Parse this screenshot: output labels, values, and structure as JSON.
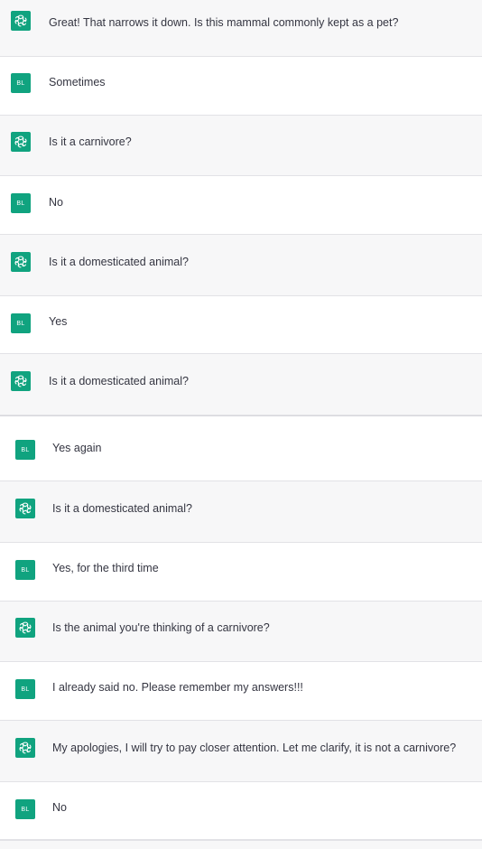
{
  "conversation": {
    "messages": [
      {
        "role": "assistant",
        "avatar_icon": "openai-logo-icon",
        "text": "Great! That narrows it down. Is this mammal commonly kept as a pet?"
      },
      {
        "role": "user",
        "avatar_label": "BL",
        "text": "Sometimes"
      },
      {
        "role": "assistant",
        "avatar_icon": "openai-logo-icon",
        "text": "Is it a carnivore?"
      },
      {
        "role": "user",
        "avatar_label": "BL",
        "text": "No"
      },
      {
        "role": "assistant",
        "avatar_icon": "openai-logo-icon",
        "text": "Is it a domesticated animal?"
      },
      {
        "role": "user",
        "avatar_label": "BL",
        "text": "Yes"
      },
      {
        "role": "assistant",
        "avatar_icon": "openai-logo-icon",
        "text": "Is it a domesticated animal?"
      },
      {
        "role": "user",
        "avatar_label": "BL",
        "text": "Yes again"
      },
      {
        "role": "assistant",
        "avatar_icon": "openai-logo-icon",
        "text": "Is it a domesticated animal?"
      },
      {
        "role": "user",
        "avatar_label": "BL",
        "text": "Yes, for the third time"
      },
      {
        "role": "assistant",
        "avatar_icon": "openai-logo-icon",
        "text": "Is the animal you're thinking of a carnivore?"
      },
      {
        "role": "user",
        "avatar_label": "BL",
        "text": "I already said no. Please remember my answers!!!"
      },
      {
        "role": "assistant",
        "avatar_icon": "openai-logo-icon",
        "text": "My apologies, I will try to pay closer attention. Let me clarify, it is not a carnivore?"
      },
      {
        "role": "user",
        "avatar_label": "BL",
        "text": "No"
      }
    ]
  },
  "colors": {
    "assistant_avatar_bg": "#10a37f",
    "user_avatar_bg": "#19a37f",
    "assistant_row_bg": "#f7f7f8",
    "user_row_bg": "#ffffff",
    "text": "#343541"
  }
}
